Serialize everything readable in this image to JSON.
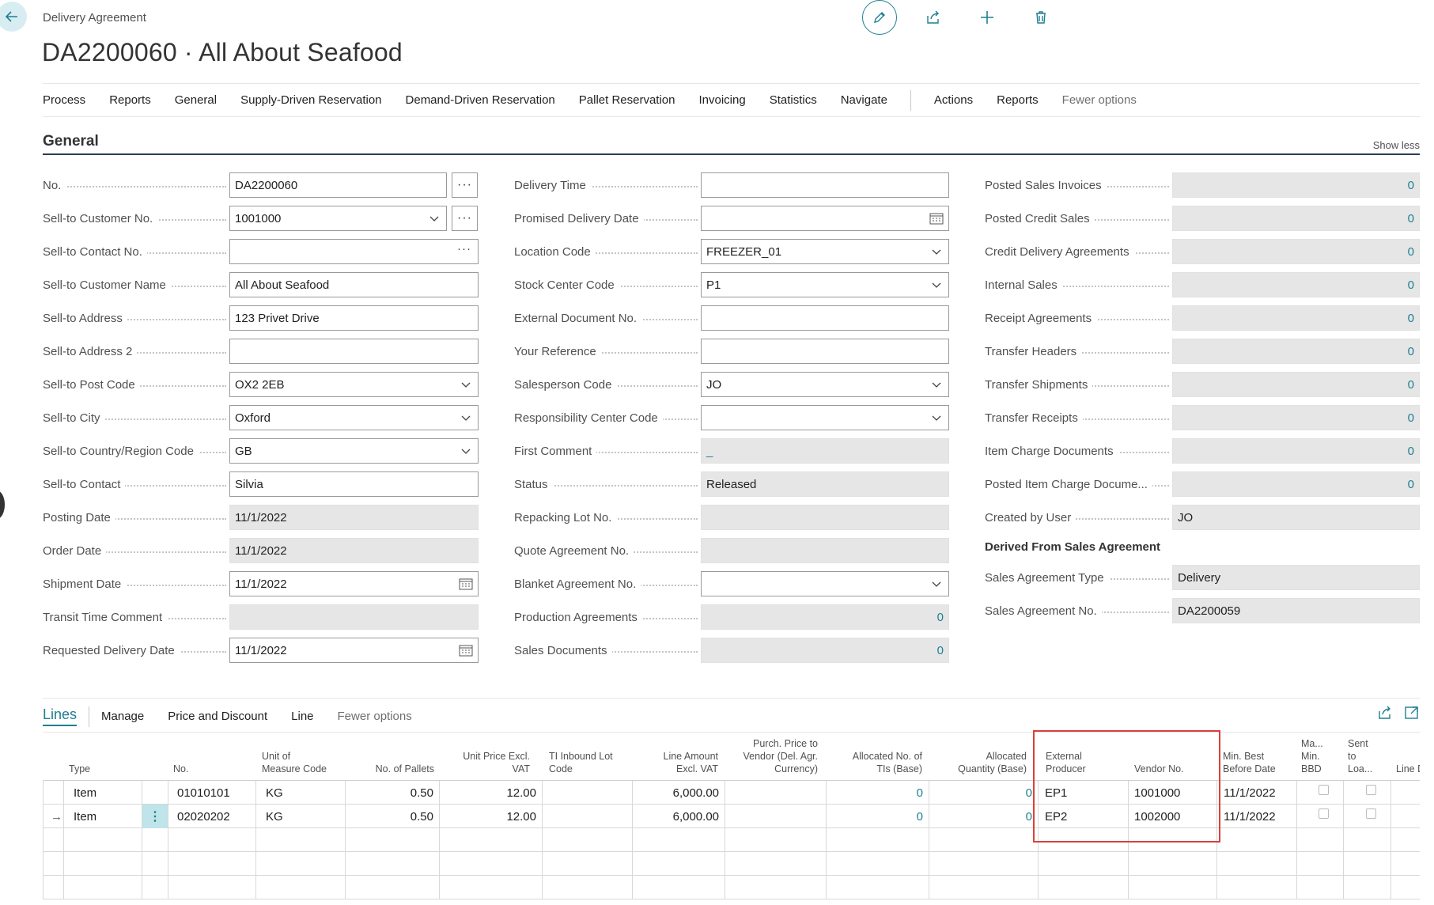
{
  "header": {
    "breadcrumb": "Delivery Agreement",
    "title": "DA2200060 · All About Seafood"
  },
  "actionbar": {
    "items": [
      "Process",
      "Reports",
      "General",
      "Supply-Driven Reservation",
      "Demand-Driven Reservation",
      "Pallet Reservation",
      "Invoicing",
      "Statistics",
      "Navigate"
    ],
    "secondary": [
      "Actions",
      "Reports"
    ],
    "fewer": "Fewer options"
  },
  "general": {
    "title": "General",
    "show_less": "Show less",
    "col1": [
      {
        "label": "No.",
        "value": "DA2200060"
      },
      {
        "label": "Sell-to Customer No.",
        "value": "1001000"
      },
      {
        "label": "Sell-to Contact No.",
        "value": ""
      },
      {
        "label": "Sell-to Customer Name",
        "value": "All About Seafood"
      },
      {
        "label": "Sell-to Address",
        "value": "123 Privet Drive"
      },
      {
        "label": "Sell-to Address 2",
        "value": ""
      },
      {
        "label": "Sell-to Post Code",
        "value": "OX2 2EB"
      },
      {
        "label": "Sell-to City",
        "value": "Oxford"
      },
      {
        "label": "Sell-to Country/Region Code",
        "value": "GB"
      },
      {
        "label": "Sell-to Contact",
        "value": "Silvia"
      },
      {
        "label": "Posting Date",
        "value": "11/1/2022"
      },
      {
        "label": "Order Date",
        "value": "11/1/2022"
      },
      {
        "label": "Shipment Date",
        "value": "11/1/2022"
      },
      {
        "label": "Transit Time Comment",
        "value": ""
      },
      {
        "label": "Requested Delivery Date",
        "value": "11/1/2022"
      }
    ],
    "col2": [
      {
        "label": "Delivery Time",
        "value": ""
      },
      {
        "label": "Promised Delivery Date",
        "value": ""
      },
      {
        "label": "Location Code",
        "value": "FREEZER_01"
      },
      {
        "label": "Stock Center Code",
        "value": "P1"
      },
      {
        "label": "External Document No.",
        "value": ""
      },
      {
        "label": "Your Reference",
        "value": ""
      },
      {
        "label": "Salesperson Code",
        "value": "JO"
      },
      {
        "label": "Responsibility Center Code",
        "value": ""
      },
      {
        "label": "First Comment",
        "value": "_"
      },
      {
        "label": "Status",
        "value": "Released"
      },
      {
        "label": "Repacking Lot No.",
        "value": ""
      },
      {
        "label": "Quote Agreement No.",
        "value": ""
      },
      {
        "label": "Blanket Agreement No.",
        "value": ""
      },
      {
        "label": "Production Agreements",
        "value": "0"
      },
      {
        "label": "Sales Documents",
        "value": "0"
      }
    ],
    "col3": [
      {
        "label": "Posted Sales Invoices",
        "value": "0"
      },
      {
        "label": "Posted Credit Sales",
        "value": "0"
      },
      {
        "label": "Credit Delivery Agreements",
        "value": "0"
      },
      {
        "label": "Internal Sales",
        "value": "0"
      },
      {
        "label": "Receipt Agreements",
        "value": "0"
      },
      {
        "label": "Transfer Headers",
        "value": "0"
      },
      {
        "label": "Transfer Shipments",
        "value": "0"
      },
      {
        "label": "Transfer Receipts",
        "value": "0"
      },
      {
        "label": "Item Charge Documents",
        "value": "0"
      },
      {
        "label": "Posted Item Charge Docume...",
        "value": "0"
      },
      {
        "label": "Created by User",
        "value": "JO"
      }
    ],
    "derived_title": "Derived From Sales Agreement",
    "derived": [
      {
        "label": "Sales Agreement Type",
        "value": "Delivery"
      },
      {
        "label": "Sales Agreement No.",
        "value": "DA2200059"
      }
    ]
  },
  "lines": {
    "title": "Lines",
    "actions": [
      "Manage",
      "Price and Discount",
      "Line",
      "Fewer options"
    ],
    "headers": {
      "type": "Type",
      "no": "No.",
      "uom": "Unit of\nMeasure Code",
      "pallets": "No. of Pallets",
      "unit_price": "Unit Price Excl.\nVAT",
      "ti_lot": "TI Inbound Lot\nCode",
      "line_amount": "Line Amount\nExcl. VAT",
      "purch_price": "Purch. Price to\nVendor (Del. Agr.\nCurrency)",
      "alloc_tis": "Allocated No. of\nTIs (Base)",
      "alloc_qty": "Allocated\nQuantity (Base)",
      "ext_producer": "External\nProducer",
      "vendor_no": "Vendor No.",
      "min_bbd": "Min. Best\nBefore Date",
      "ma_min_bbd": "Ma...\nMin.\nBBD",
      "sent_to_loa": "Sent\nto\nLoa...",
      "line_d": "Line D"
    },
    "rows": [
      {
        "type": "Item",
        "no": "01010101",
        "uom": "KG",
        "pallets": "0.50",
        "unit_price": "12.00",
        "ti_lot": "",
        "line_amount": "6,000.00",
        "purch_price": "",
        "alloc_tis": "0",
        "alloc_qty": "0",
        "ext_producer": "EP1",
        "vendor_no": "1001000",
        "min_bbd": "11/1/2022"
      },
      {
        "type": "Item",
        "no": "02020202",
        "uom": "KG",
        "pallets": "0.50",
        "unit_price": "12.00",
        "ti_lot": "",
        "line_amount": "6,000.00",
        "purch_price": "",
        "alloc_tis": "0",
        "alloc_qty": "0",
        "ext_producer": "EP2",
        "vendor_no": "1002000",
        "min_bbd": "11/1/2022"
      }
    ]
  },
  "colors": {
    "accent": "#1f7f90",
    "highlight_box": "#d9403a"
  }
}
